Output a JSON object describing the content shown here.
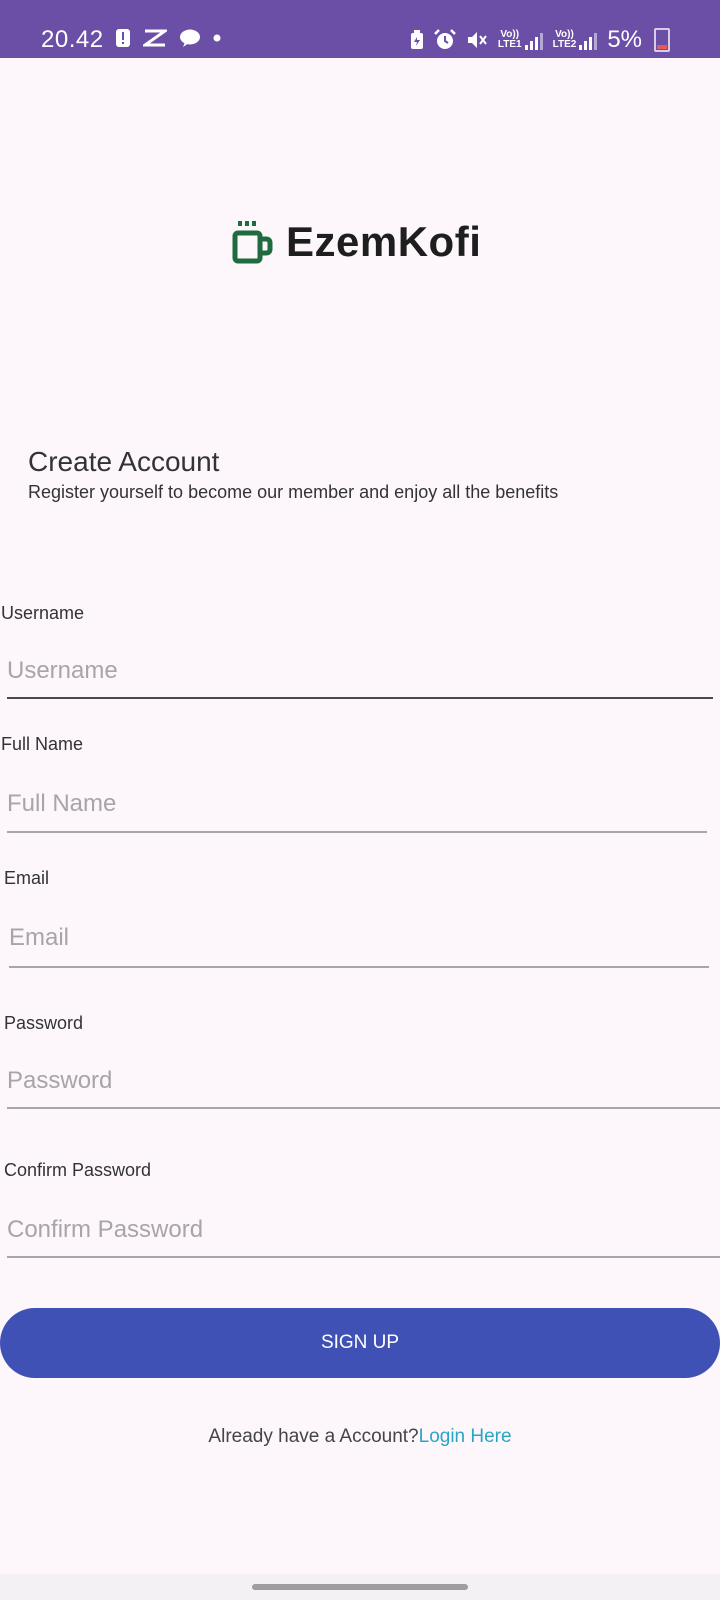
{
  "status_bar": {
    "time": "20.42",
    "battery": "5%",
    "sim1": {
      "line1": "Vo))",
      "line2": "LTE1"
    },
    "sim2": {
      "line1": "Vo))",
      "line2": "LTE2"
    },
    "left_icons": [
      "alert-icon",
      "capcut-icon",
      "chat-icon",
      "dot-icon"
    ],
    "right_icons": [
      "battery-saver-icon",
      "alarm-icon",
      "mute-icon"
    ]
  },
  "brand": {
    "name": "EzemKofi",
    "logo_icon": "coffee-mug-icon",
    "color": "#1e6b3f"
  },
  "header": {
    "title": "Create Account",
    "subtitle": "Register yourself to become our member and enjoy all the benefits"
  },
  "form": {
    "username": {
      "label": "Username",
      "placeholder": "Username",
      "value": ""
    },
    "full_name": {
      "label": "Full Name",
      "placeholder": "Full Name",
      "value": ""
    },
    "email": {
      "label": "Email",
      "placeholder": "Email",
      "value": ""
    },
    "password": {
      "label": "Password",
      "placeholder": "Password",
      "value": ""
    },
    "confirm_password": {
      "label": "Confirm Password",
      "placeholder": "Confirm Password",
      "value": ""
    }
  },
  "actions": {
    "signup_label": "SIGN UP",
    "login_prompt": "Already have a Account?",
    "login_link": "Login Here"
  },
  "colors": {
    "status_bar": "#6b4fa6",
    "button": "#3f51b5",
    "link": "#29a6c4",
    "background": "#fdf7fc"
  }
}
